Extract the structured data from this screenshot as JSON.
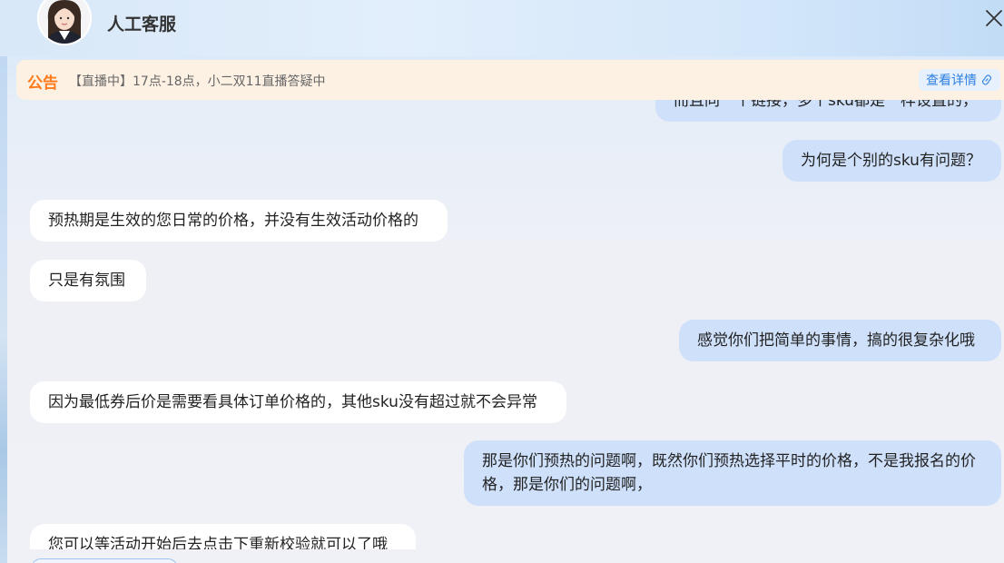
{
  "header": {
    "title": "人工客服",
    "avatar_icon": "agent-avatar",
    "close_icon": "close-icon"
  },
  "notice": {
    "tag": "公告",
    "text": "【直播中】17点-18点，小二双11直播答疑中",
    "link_label": "查看详情",
    "link_icon": "link-icon"
  },
  "messages": [
    {
      "role": "me",
      "text": "而且同一个链接，多个sku都是一样设置的，"
    },
    {
      "role": "me",
      "text": "为何是个别的sku有问题？"
    },
    {
      "role": "agent",
      "text": "预热期是生效的您日常的价格，并没有生效活动价格的"
    },
    {
      "role": "agent",
      "text": "只是有氛围"
    },
    {
      "role": "me",
      "text": "感觉你们把简单的事情，搞的很复杂化哦"
    },
    {
      "role": "agent",
      "text": "因为最低券后价是需要看具体订单价格的，其他sku没有超过就不会异常"
    },
    {
      "role": "me",
      "text": "那是你们预热的问题啊，既然你们预热选择平时的价格，不是我报名的价格，那是你们的问题啊，"
    },
    {
      "role": "agent",
      "text": "您可以等活动开始后去点击下重新校验就可以了哦"
    }
  ],
  "colors": {
    "accent": "#ff7a1a",
    "link": "#2b7fe0",
    "my_bubble": "#cfe0fb",
    "agent_bubble": "#ffffff"
  }
}
